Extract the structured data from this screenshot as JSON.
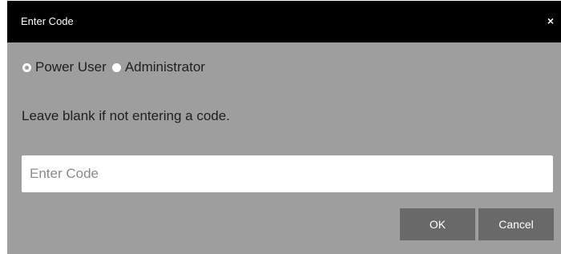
{
  "dialog": {
    "title": "Enter Code",
    "close_glyph": "×"
  },
  "roles": {
    "options": [
      {
        "label": "Power User",
        "selected": true
      },
      {
        "label": "Administrator",
        "selected": false
      }
    ]
  },
  "hint": "Leave blank if not entering a code.",
  "code_input": {
    "value": "",
    "placeholder": "Enter Code"
  },
  "buttons": {
    "ok_label": "OK",
    "cancel_label": "Cancel"
  },
  "colors": {
    "titlebar": "#000000",
    "dialog_body": "#9e9e9e",
    "button": "#696969"
  }
}
